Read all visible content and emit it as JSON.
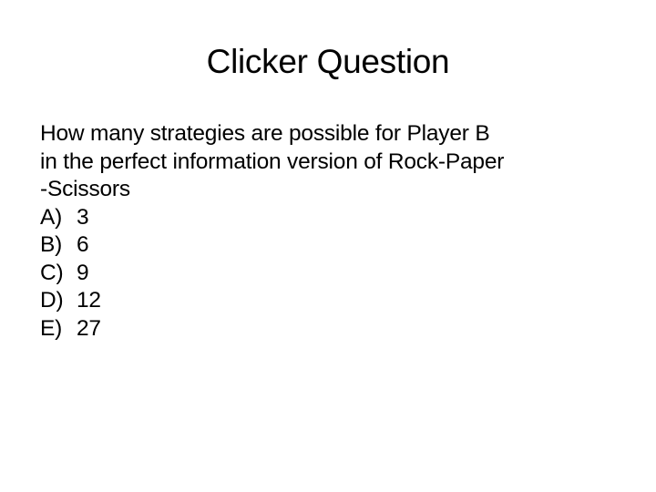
{
  "slide": {
    "title": "Clicker Question",
    "question_lines": [
      "How many strategies are possible for Player B",
      "in the perfect information version of Rock-Paper",
      "-Scissors"
    ],
    "options": [
      {
        "letter": "A)",
        "value": "3"
      },
      {
        "letter": "B)",
        "value": "6"
      },
      {
        "letter": "C)",
        "value": "9"
      },
      {
        "letter": "D)",
        "value": "12"
      },
      {
        "letter": "E)",
        "value": "27"
      }
    ]
  }
}
